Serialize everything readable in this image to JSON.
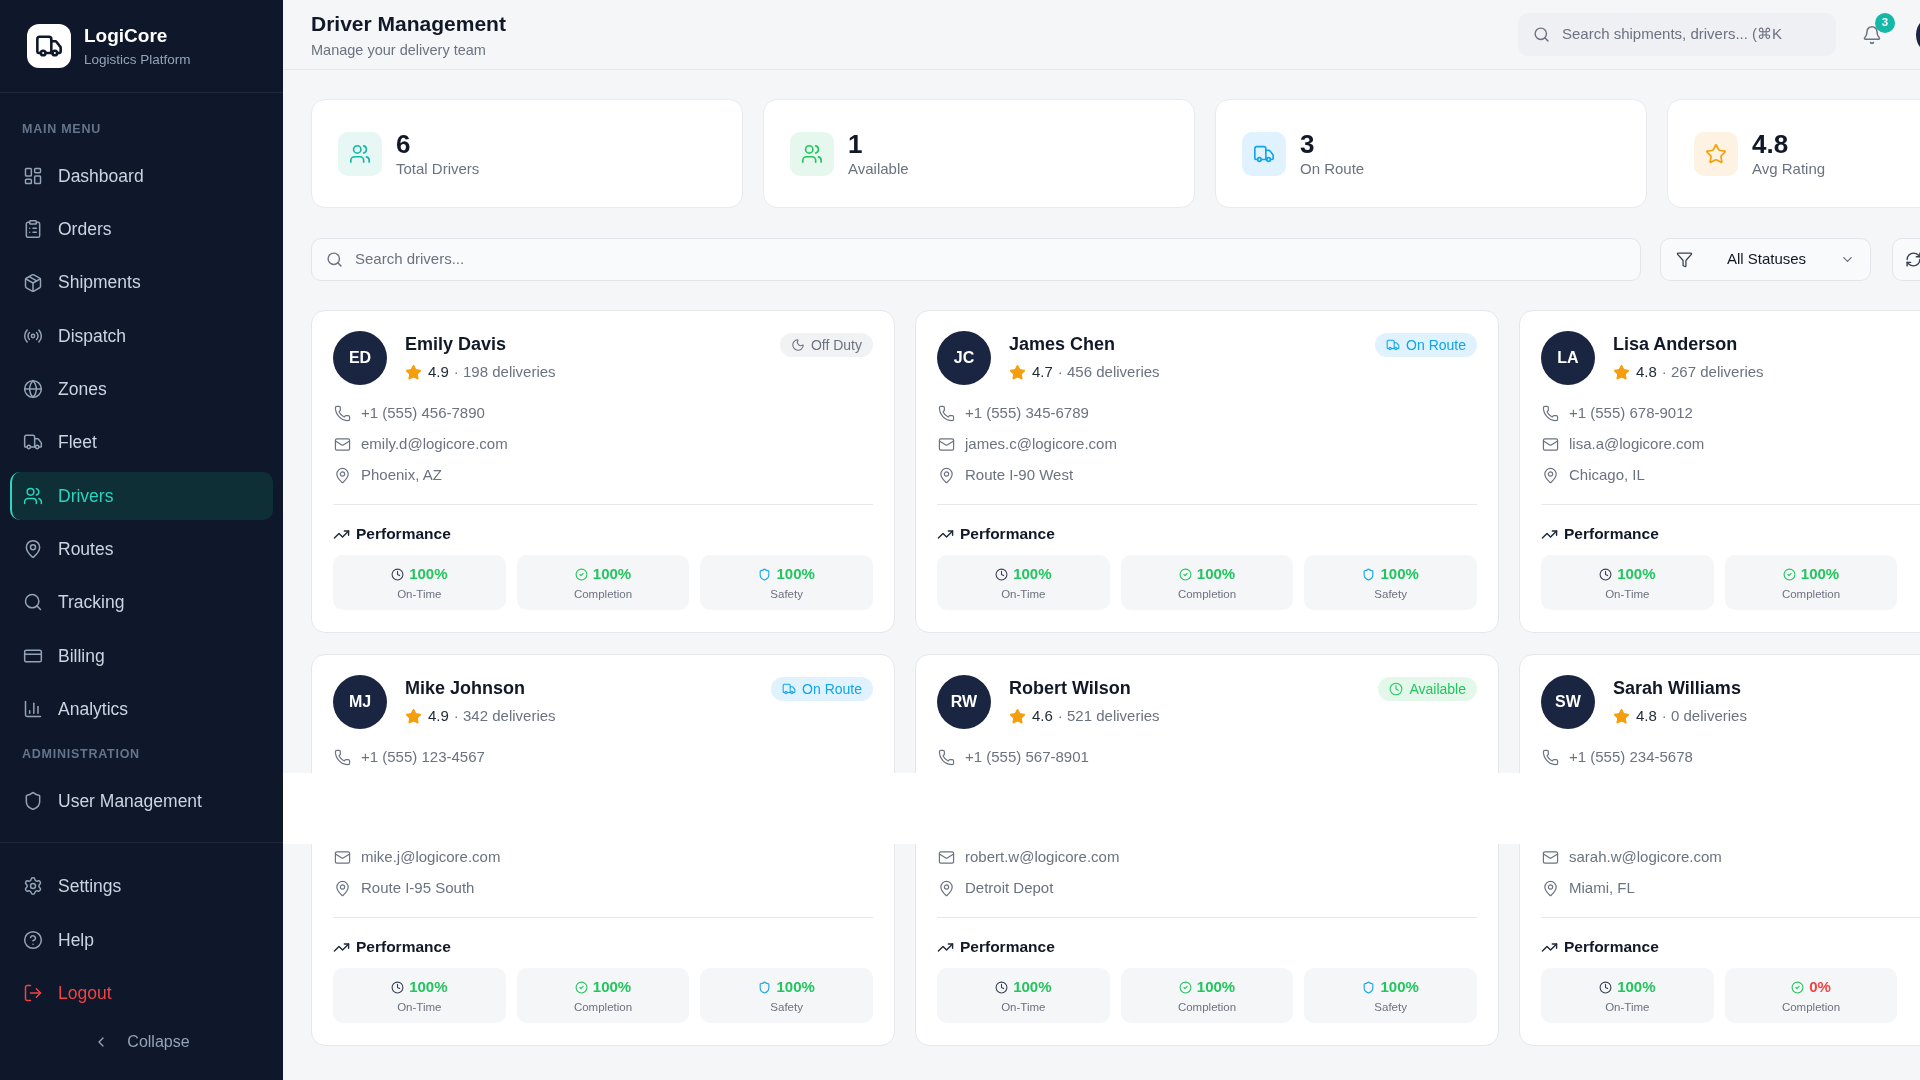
{
  "sidebar": {
    "brand": {
      "name": "LogiCore",
      "tagline": "Logistics Platform"
    },
    "sections": [
      {
        "heading": "MAIN MENU",
        "items": [
          {
            "label": "Dashboard",
            "selected": false
          },
          {
            "label": "Orders",
            "selected": false
          },
          {
            "label": "Shipments",
            "selected": false
          },
          {
            "label": "Dispatch",
            "selected": false
          },
          {
            "label": "Zones",
            "selected": false
          },
          {
            "label": "Fleet",
            "selected": false
          },
          {
            "label": "Drivers",
            "selected": true
          },
          {
            "label": "Routes",
            "selected": false
          },
          {
            "label": "Tracking",
            "selected": false
          },
          {
            "label": "Billing",
            "selected": false
          },
          {
            "label": "Analytics",
            "selected": false
          }
        ]
      },
      {
        "heading": "ADMINISTRATION",
        "items": [
          {
            "label": "User Management",
            "selected": false
          }
        ]
      }
    ],
    "footer_items": [
      {
        "label": "Settings",
        "kind": "normal",
        "selected": false
      },
      {
        "label": "Help",
        "kind": "normal",
        "selected": false
      },
      {
        "label": "Logout",
        "kind": "danger",
        "selected": false
      }
    ],
    "collapse": {
      "label": "Collapse"
    }
  },
  "header": {
    "title": "Driver Management",
    "subtitle": "Manage your delivery team",
    "search": {
      "placeholder": "Search shipments, drivers... (⌘K"
    },
    "notifications": {
      "count": "3"
    }
  },
  "stats": [
    {
      "kind": "drivers",
      "value": "6",
      "label": "Total Drivers"
    },
    {
      "kind": "available",
      "value": "1",
      "label": "Available"
    },
    {
      "kind": "on_route",
      "value": "3",
      "label": "On Route"
    },
    {
      "kind": "rating",
      "value": "4.8",
      "label": "Avg Rating"
    }
  ],
  "filters": {
    "search": {
      "placeholder": "Search drivers..."
    },
    "status_select": {
      "value": "All Statuses"
    }
  },
  "drivers": [
    {
      "initials": "ED",
      "name": "Emily Davis",
      "rating": "4.9",
      "deliveries": "· 198 deliveries",
      "status": {
        "kind": "off_duty",
        "label": "Off Duty"
      },
      "phone": "+1 (555) 456-7890",
      "email": "emily.d@logicore.com",
      "location": "Phoenix, AZ",
      "performance": {
        "title": "Performance",
        "metrics": [
          {
            "kind": "on_time",
            "value": "100%",
            "label": "On-Time",
            "alert": false
          },
          {
            "kind": "completion",
            "value": "100%",
            "label": "Completion",
            "alert": false
          },
          {
            "kind": "safety",
            "value": "100%",
            "label": "Safety",
            "alert": false
          }
        ]
      }
    },
    {
      "initials": "JC",
      "name": "James Chen",
      "rating": "4.7",
      "deliveries": "· 456 deliveries",
      "status": {
        "kind": "on_route",
        "label": "On Route"
      },
      "phone": "+1 (555) 345-6789",
      "email": "james.c@logicore.com",
      "location": "Route I-90 West",
      "performance": {
        "title": "Performance",
        "metrics": [
          {
            "kind": "on_time",
            "value": "100%",
            "label": "On-Time",
            "alert": false
          },
          {
            "kind": "completion",
            "value": "100%",
            "label": "Completion",
            "alert": false
          },
          {
            "kind": "safety",
            "value": "100%",
            "label": "Safety",
            "alert": false
          }
        ]
      }
    },
    {
      "initials": "LA",
      "name": "Lisa Anderson",
      "rating": "4.8",
      "deliveries": "· 267 deliveries",
      "phone": "+1 (555) 678-9012",
      "email": "lisa.a@logicore.com",
      "location": "Chicago, IL",
      "performance": {
        "title": "Performance",
        "metrics": [
          {
            "kind": "on_time",
            "value": "100%",
            "label": "On-Time",
            "alert": false
          },
          {
            "kind": "completion",
            "value": "100%",
            "label": "Completion",
            "alert": false
          }
        ]
      }
    },
    {
      "initials": "MJ",
      "name": "Mike Johnson",
      "rating": "4.9",
      "deliveries": "· 342 deliveries",
      "status": {
        "kind": "on_route",
        "label": "On Route"
      },
      "phone": "+1 (555) 123-4567",
      "email": "mike.j@logicore.com",
      "location": "Route I-95 South",
      "performance": {
        "title": "Performance",
        "metrics": [
          {
            "kind": "on_time",
            "value": "100%",
            "label": "On-Time",
            "alert": false
          },
          {
            "kind": "completion",
            "value": "100%",
            "label": "Completion",
            "alert": false
          },
          {
            "kind": "safety",
            "value": "100%",
            "label": "Safety",
            "alert": false
          }
        ]
      }
    },
    {
      "initials": "RW",
      "name": "Robert Wilson",
      "rating": "4.6",
      "deliveries": "· 521 deliveries",
      "status": {
        "kind": "available",
        "label": "Available"
      },
      "phone": "+1 (555) 567-8901",
      "email": "robert.w@logicore.com",
      "location": "Detroit Depot",
      "performance": {
        "title": "Performance",
        "metrics": [
          {
            "kind": "on_time",
            "value": "100%",
            "label": "On-Time",
            "alert": false
          },
          {
            "kind": "completion",
            "value": "100%",
            "label": "Completion",
            "alert": false
          },
          {
            "kind": "safety",
            "value": "100%",
            "label": "Safety",
            "alert": false
          }
        ]
      }
    },
    {
      "initials": "SW",
      "name": "Sarah Williams",
      "rating": "4.8",
      "deliveries": "· 0 deliveries",
      "phone": "+1 (555) 234-5678",
      "email": "sarah.w@logicore.com",
      "location": "Miami, FL",
      "performance": {
        "title": "Performance",
        "metrics": [
          {
            "kind": "on_time",
            "value": "100%",
            "label": "On-Time",
            "alert": false
          },
          {
            "kind": "completion",
            "value": "0%",
            "label": "Completion",
            "alert": true
          }
        ]
      }
    }
  ]
}
